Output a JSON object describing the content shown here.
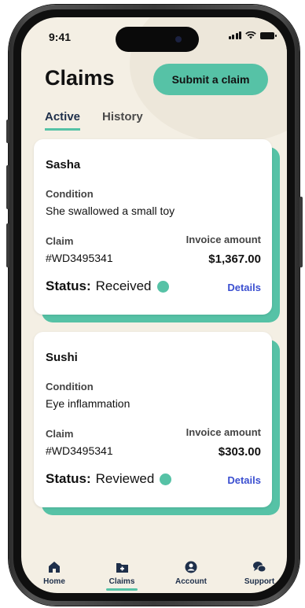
{
  "status_bar": {
    "time": "9:41"
  },
  "header": {
    "title": "Claims",
    "submit_label": "Submit a claim"
  },
  "tabs": [
    {
      "label": "Active",
      "active": true
    },
    {
      "label": "History",
      "active": false
    }
  ],
  "claims": [
    {
      "pet_name": "Sasha",
      "condition_label": "Condition",
      "condition": "She swallowed a small toy",
      "claim_label": "Claim",
      "claim_number": "#WD3495341",
      "invoice_label": "Invoice amount",
      "invoice_amount": "$1,367.00",
      "status_label": "Status:",
      "status": "Received",
      "details_label": "Details"
    },
    {
      "pet_name": "Sushi",
      "condition_label": "Condition",
      "condition": "Eye inflammation",
      "claim_label": "Claim",
      "claim_number": "#WD3495341",
      "invoice_label": "Invoice amount",
      "invoice_amount": "$303.00",
      "status_label": "Status:",
      "status": "Reviewed",
      "details_label": "Details"
    }
  ],
  "bottom_nav": [
    {
      "label": "Home",
      "icon": "home-icon",
      "active": false
    },
    {
      "label": "Claims",
      "icon": "claims-icon",
      "active": true
    },
    {
      "label": "Account",
      "icon": "account-icon",
      "active": false
    },
    {
      "label": "Support",
      "icon": "support-icon",
      "active": false
    }
  ],
  "colors": {
    "accent": "#56c2a6",
    "link": "#3b4fd0",
    "background": "#f4efe4",
    "text_dark": "#1e2f4a"
  }
}
